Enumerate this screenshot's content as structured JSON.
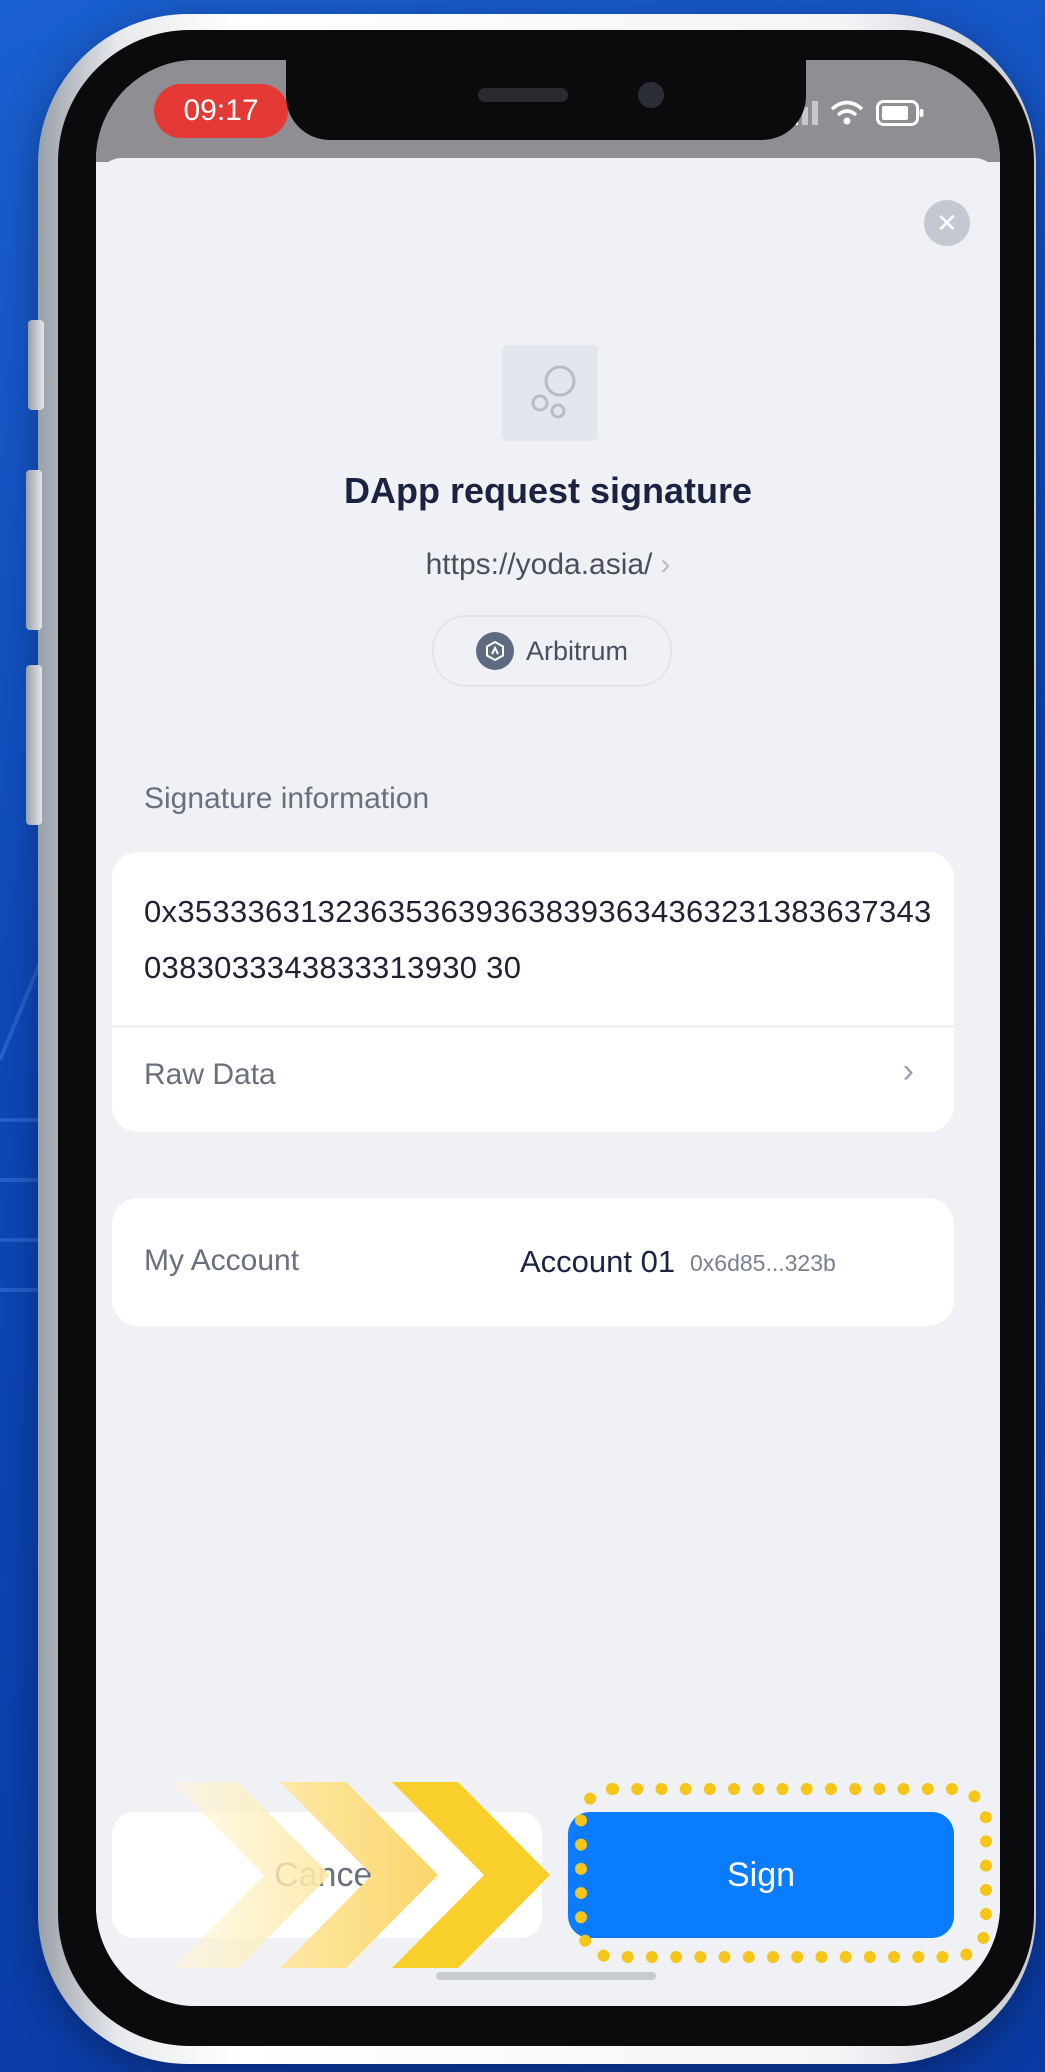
{
  "status_bar": {
    "time": "09:17"
  },
  "modal": {
    "title": "DApp request signature",
    "url": "https://yoda.asia/",
    "chain": "Arbitrum",
    "signature_section_label": "Signature information",
    "signature_hex": "0x35333631323635363936383936343632313836373430383033343833313930 30",
    "raw_data_label": "Raw Data",
    "account_label": "My Account",
    "account_name": "Account 01",
    "account_address": "0x6d85...323b",
    "cancel_label": "Cancel",
    "sign_label": "Sign"
  },
  "colors": {
    "background": "#0d47b8",
    "sign_button": "#0a7cff",
    "highlight": "#f5c518",
    "time_pill": "#e53935"
  },
  "icons": [
    "close-icon",
    "dapp-logo-icon",
    "arbitrum-icon",
    "chevron-right-icon",
    "signal-icon",
    "wifi-icon",
    "battery-icon"
  ]
}
